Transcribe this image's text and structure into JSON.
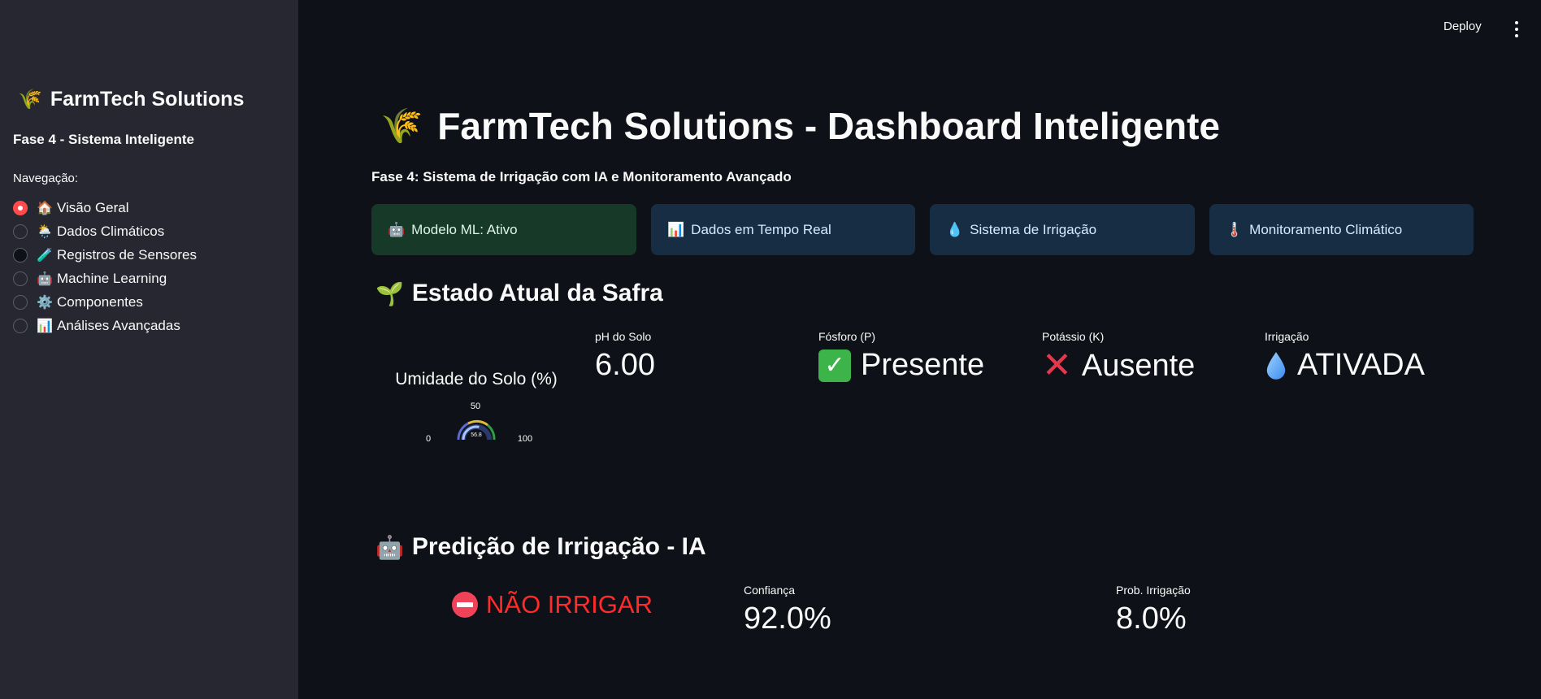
{
  "topbar": {
    "deploy_label": "Deploy",
    "menu_icon": "kebab-menu-icon"
  },
  "sidebar": {
    "title": "FarmTech Solutions",
    "title_icon": "🌾",
    "subtitle": "Fase 4 - Sistema Inteligente",
    "nav_label": "Navegação:",
    "items": [
      {
        "emoji": "🏠",
        "label": "Visão Geral",
        "selected": true
      },
      {
        "emoji": "🌦️",
        "label": "Dados Climáticos",
        "selected": false
      },
      {
        "emoji": "🧪",
        "label": "Registros de Sensores",
        "selected": false
      },
      {
        "emoji": "🤖",
        "label": "Machine Learning",
        "selected": false
      },
      {
        "emoji": "⚙️",
        "label": "Componentes",
        "selected": false
      },
      {
        "emoji": "📊",
        "label": "Análises Avançadas",
        "selected": false
      }
    ]
  },
  "main": {
    "title": "FarmTech Solutions - Dashboard Inteligente",
    "title_icon": "🌾",
    "subtitle": "Fase 4: Sistema de Irrigação com IA e Monitoramento Avançado",
    "status_cards": [
      {
        "emoji": "🤖",
        "label": "Modelo ML: Ativo"
      },
      {
        "emoji": "📊",
        "label": "Dados em Tempo Real"
      },
      {
        "emoji": "💧",
        "label": "Sistema de Irrigação"
      },
      {
        "emoji": "🌡️",
        "label": "Monitoramento Climático"
      }
    ],
    "crop_section": {
      "emoji": "🌱",
      "title": "Estado Atual da Safra",
      "gauge": {
        "title": "Umidade do Solo (%)",
        "value": 56.8,
        "value_text": "56.8",
        "min": 0,
        "mid": 50,
        "max": 100,
        "min_label": "0",
        "mid_label": "50",
        "max_label": "100"
      },
      "metrics": [
        {
          "label": "pH do Solo",
          "value": "6.00"
        },
        {
          "label": "Fósforo (P)",
          "value": "Presente",
          "icon": "check-mark-icon"
        },
        {
          "label": "Potássio (K)",
          "value": "Ausente",
          "icon": "cross-mark-icon"
        },
        {
          "label": "Irrigação",
          "value": "ATIVADA",
          "icon": "water-drop-icon"
        }
      ]
    },
    "prediction_section": {
      "emoji": "🤖",
      "title": "Predição de Irrigação - IA",
      "result": "NÃO IRRIGAR",
      "result_color": "#ff2b2b",
      "metrics": [
        {
          "label": "Confiança",
          "value": "92.0%"
        },
        {
          "label": "Prob. Irrigação",
          "value": "8.0%"
        }
      ]
    }
  },
  "colors": {
    "background": "#0e1117",
    "sidebar": "#262730",
    "accent": "#ff4b4b",
    "card_green": "#173928",
    "card_blue": "#172d43"
  }
}
